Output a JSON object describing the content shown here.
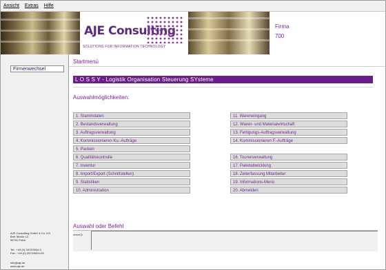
{
  "menu": {
    "items": [
      "Ansicht",
      "Extras",
      "Hilfe"
    ]
  },
  "header": {
    "logo_text": "AJE Consulting",
    "tagline": "SOLUTIONS FOR INFORMATION TECHNOLOGY",
    "firma_label": "Firma",
    "firma_value": "700",
    "brand_color": "#6a1e8a"
  },
  "sidebar": {
    "button": "Firmenwechsel",
    "address": [
      "AJE Consulting GmbH & Co. KG",
      "Bret Straße 12",
      "56751 Polch",
      "",
      "Tel.: +49 (0) 2672/9004-0",
      "Fax.: +49 (0) 2672/9004-93",
      "",
      "info@aje.de",
      "www.aje.de"
    ]
  },
  "main": {
    "breadcrumb": "Startmenü",
    "title": "L O S S Y - Logistik Organisation Steuerung SYsteme",
    "section": "Auswahlmöglichkeiten:",
    "left_options": [
      "1. Stammdaten",
      "2. Bestandsverwaltung",
      "3. Auftragsverwaltung",
      "4. Kommissionieren Ku.-Aufträge",
      "5. Packen",
      "6. Qualitätskontrolle",
      "7. Inventur",
      "8. Import/Export (Schnittstellen)",
      "9. Statistiken",
      "10. Administration"
    ],
    "right_options": [
      "11. Wareneingang",
      "12. Waren- und Materialwirtschaft",
      "13. Fertigungs-Auftragsverwaltung",
      "14. Kommissionieren F.-Aufträge",
      "",
      "16. Tourenverwaltung",
      "17. Paketabwicklung",
      "18. Zeiterfassung Mitarbeiter",
      "19. Informations-Menü",
      "20. Abmelden"
    ],
    "command_label": "Auswahl oder Befehl",
    "prompt": "===>",
    "command_value": ""
  }
}
